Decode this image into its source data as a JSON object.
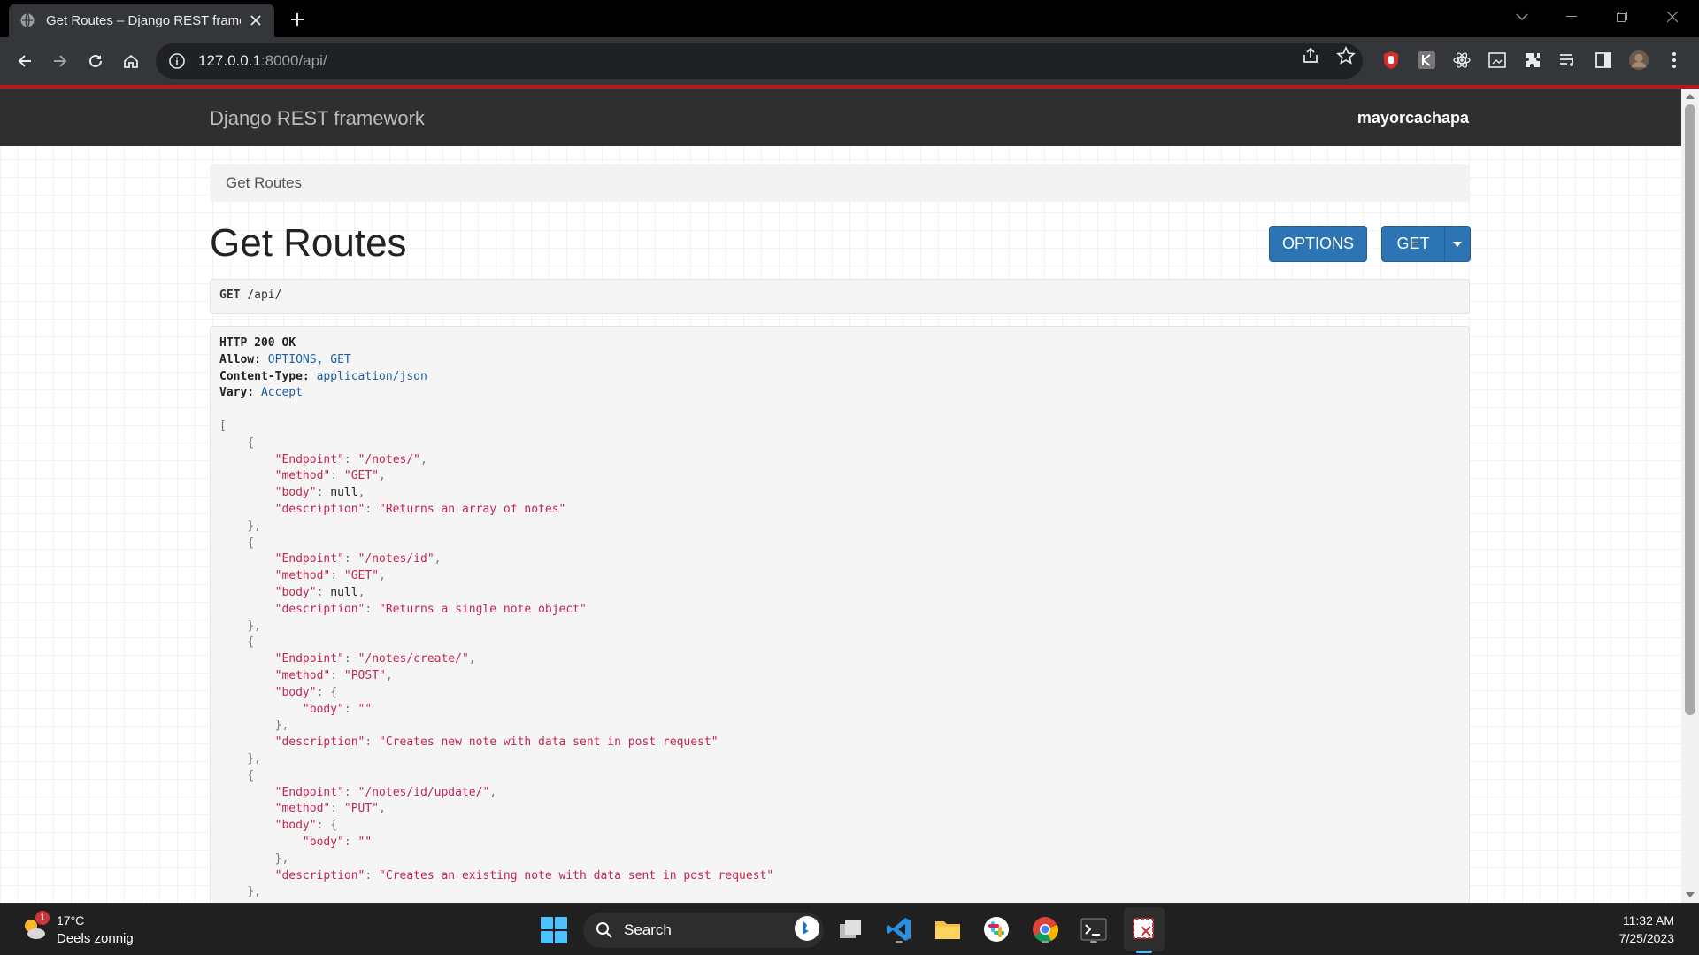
{
  "browser": {
    "tab_title": "Get Routes – Django REST framew",
    "url_host": "127.0.0.1",
    "url_path": ":8000/api/",
    "icons": [
      "globe-icon",
      "close-icon",
      "plus-icon",
      "back-icon",
      "forward-icon",
      "reload-icon",
      "home-icon",
      "info-icon",
      "share-icon",
      "star-icon",
      "extensions-icon",
      "menu-icon"
    ]
  },
  "drf": {
    "brand": "Django REST framework",
    "user": "mayorcachapa",
    "breadcrumb": "Get Routes",
    "title": "Get Routes",
    "options_label": "OPTIONS",
    "get_label": "GET",
    "request_method": "GET",
    "request_path": "/api/"
  },
  "response": {
    "status": "HTTP 200 OK",
    "headers": [
      {
        "key": "Allow:",
        "value": "OPTIONS, GET"
      },
      {
        "key": "Content-Type:",
        "value": "application/json"
      },
      {
        "key": "Vary:",
        "value": "Accept"
      }
    ],
    "routes": [
      {
        "Endpoint": "/notes/",
        "method": "GET",
        "body": null,
        "description": "Returns an array of notes"
      },
      {
        "Endpoint": "/notes/id",
        "method": "GET",
        "body": null,
        "description": "Returns a single note object"
      },
      {
        "Endpoint": "/notes/create/",
        "method": "POST",
        "body": {
          "body": ""
        },
        "description": "Creates new note with data sent in post request"
      },
      {
        "Endpoint": "/notes/id/update/",
        "method": "PUT",
        "body": {
          "body": ""
        },
        "description": "Creates an existing note with data sent in post request"
      }
    ]
  },
  "taskbar": {
    "temperature": "17°C",
    "condition": "Deels zonnig",
    "weather_badge": "1",
    "search_label": "Search",
    "time": "11:32 AM",
    "date": "7/25/2023"
  }
}
